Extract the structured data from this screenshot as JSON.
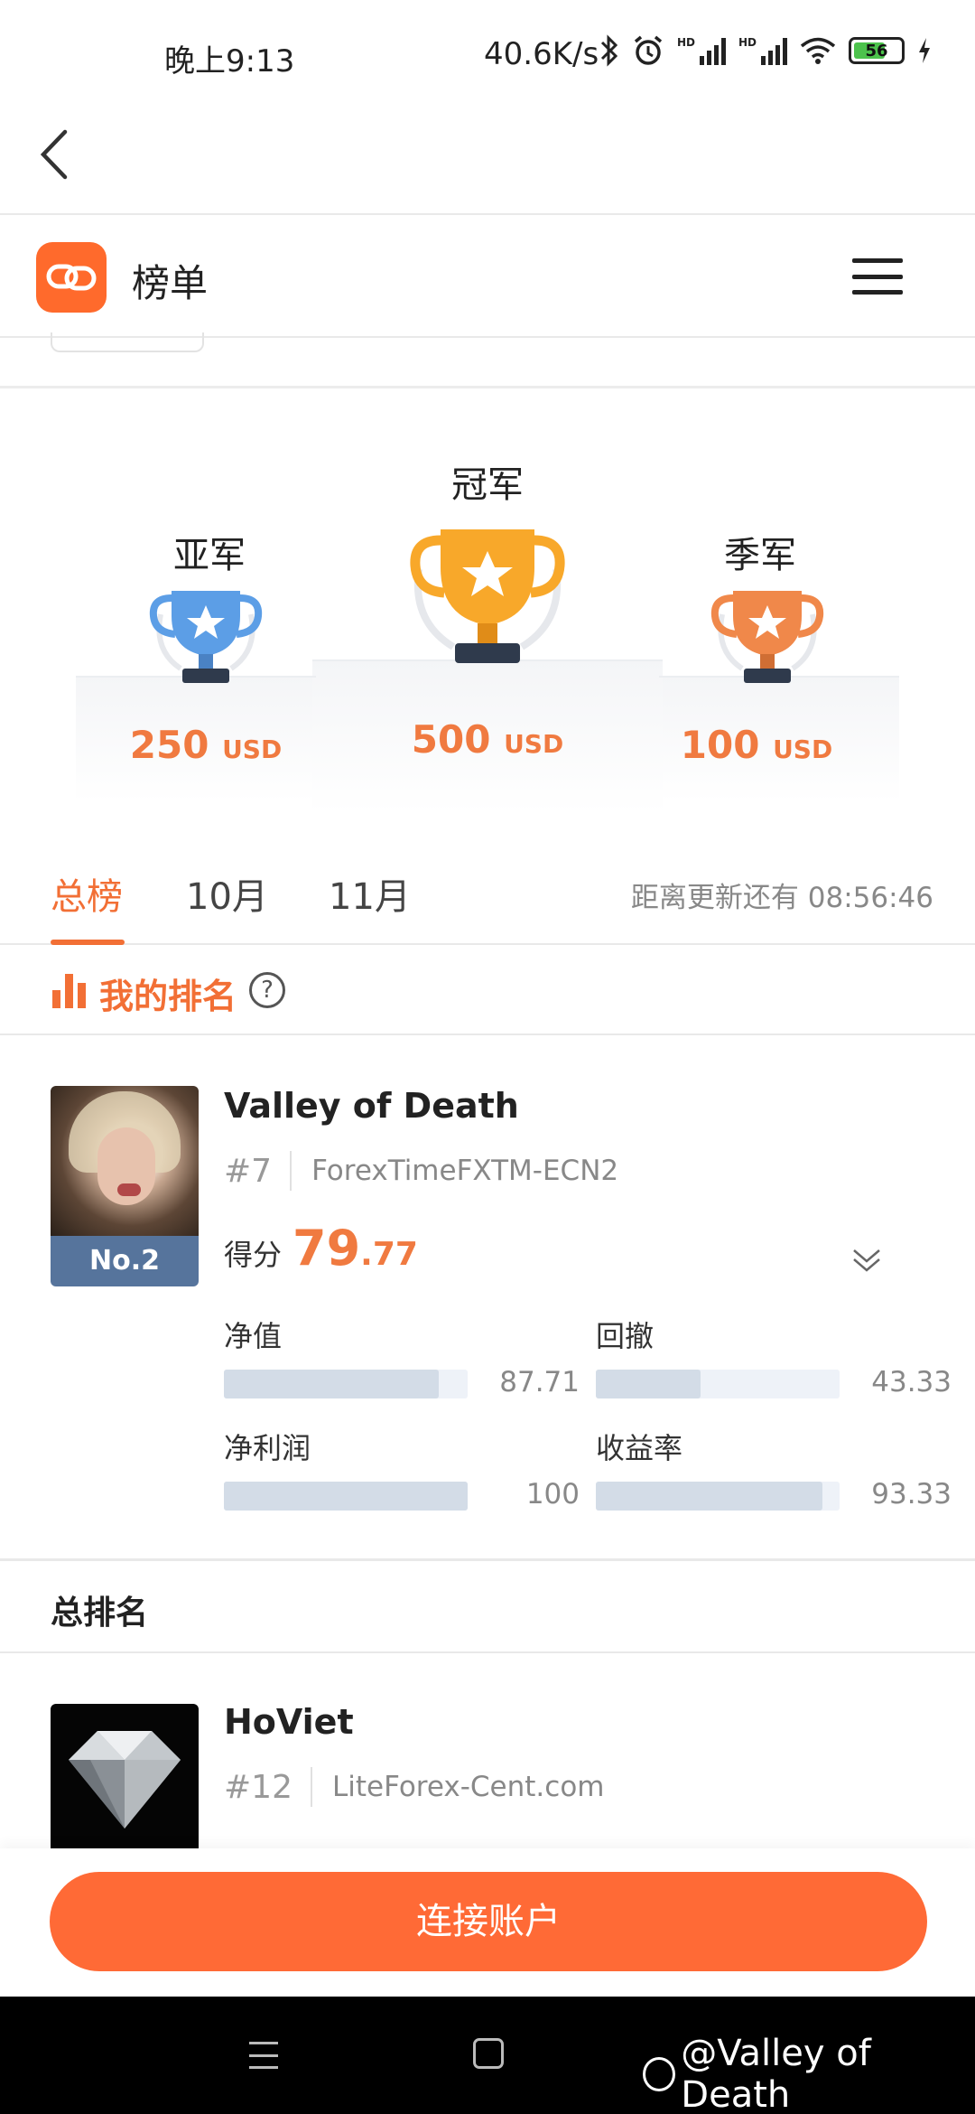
{
  "status_bar": {
    "time": "晚上9:13",
    "speed": "40.6K/s",
    "battery_level": "56",
    "icons": [
      "bluetooth-icon",
      "alarm-icon",
      "signal-hd-icon",
      "signal-hd-icon",
      "wifi-icon",
      "battery-icon",
      "charging-icon"
    ]
  },
  "header": {
    "title": "榜单",
    "accent_color": "#f26f35"
  },
  "podium": {
    "second": {
      "label": "亚军",
      "amount": "250",
      "unit": "USD"
    },
    "first": {
      "label": "冠军",
      "amount": "500",
      "unit": "USD"
    },
    "third": {
      "label": "季军",
      "amount": "100",
      "unit": "USD"
    }
  },
  "tabs": {
    "items": [
      {
        "label": "总榜",
        "active": true
      },
      {
        "label": "10月",
        "active": false
      },
      {
        "label": "11月",
        "active": false
      }
    ],
    "countdown": "距离更新还有 08:56:46"
  },
  "my_ranking": {
    "title": "我的排名",
    "help": "?",
    "user": {
      "name": "Valley of Death",
      "rank": "#7",
      "broker": "ForexTimeFXTM-ECN2",
      "badge": "No.2",
      "score_label": "得分",
      "score_int": "79",
      "score_dec": ".77"
    },
    "metrics": [
      {
        "label": "净值",
        "value": "87.71",
        "fraction": 0.88
      },
      {
        "label": "回撤",
        "value": "43.33",
        "fraction": 0.43
      },
      {
        "label": "净利润",
        "value": "100",
        "fraction": 1.0
      },
      {
        "label": "收益率",
        "value": "93.33",
        "fraction": 0.93
      }
    ]
  },
  "total_ranking": {
    "title": "总排名",
    "rows": [
      {
        "name": "HoViet",
        "rank": "#12",
        "broker": "LiteForex-Cent.com"
      }
    ]
  },
  "cta": {
    "label": "连接账户"
  },
  "watermark": {
    "text": "@Valley of Death"
  }
}
